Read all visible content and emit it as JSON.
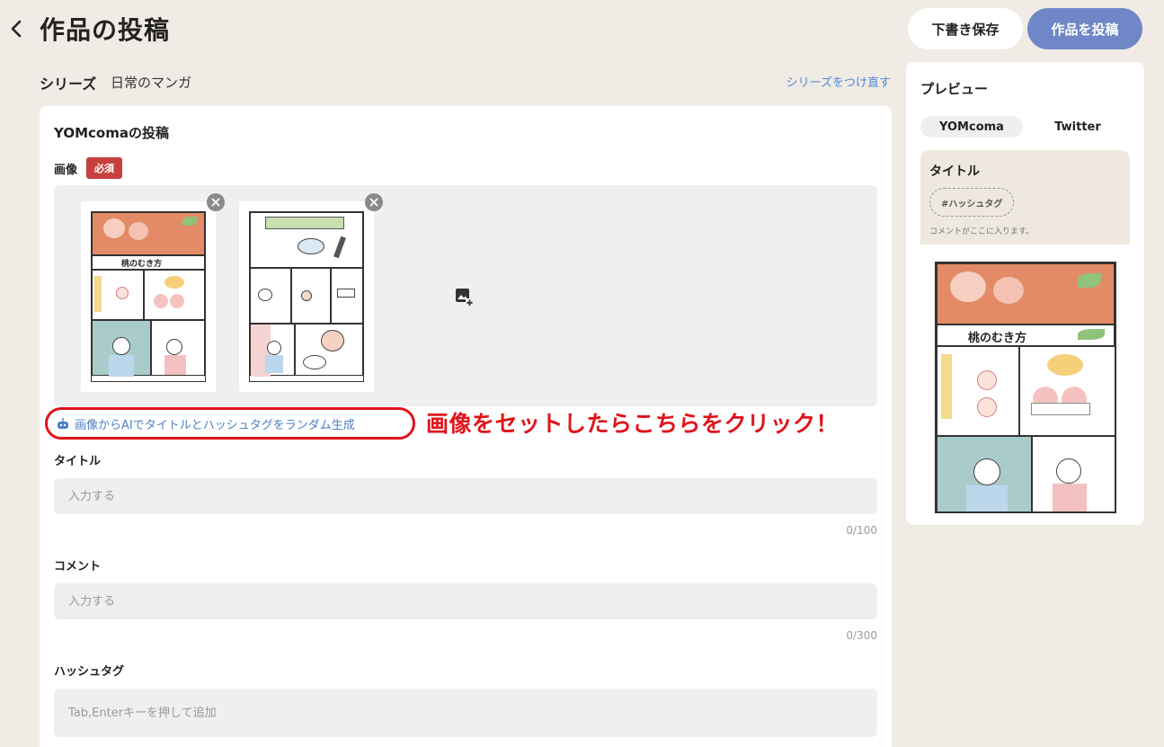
{
  "header": {
    "title": "作品の投稿",
    "draft_label": "下書き保存",
    "post_label": "作品を投稿"
  },
  "series": {
    "label": "シリーズ",
    "value": "日常のマンガ",
    "reset_label": "シリーズをつけ直す"
  },
  "form": {
    "section_title": "YOMcomaの投稿",
    "image_label": "画像",
    "required_label": "必須",
    "ai_generate_label": "画像からAIでタイトルとハッシュタグをランダム生成",
    "annotation": "画像をセットしたらこちらをクリック！",
    "title": {
      "label": "タイトル",
      "placeholder": "入力する",
      "counter": "0/100"
    },
    "comment": {
      "label": "コメント",
      "placeholder": "入力する",
      "counter": "0/300"
    },
    "hashtag": {
      "label": "ハッシュタグ",
      "placeholder": "Tab,Enterキーを押して追加"
    }
  },
  "preview": {
    "title": "プレビュー",
    "tabs": [
      "YOMcoma",
      "Twitter"
    ],
    "active_tab": "YOMcoma",
    "box_title": "タイトル",
    "hashtag_placeholder": "#ハッシュタグ",
    "comment_placeholder": "コメントがここに入ります。",
    "manga_heading": "桃のむき方"
  },
  "thumbnails": {
    "first_heading": "桃のむき方"
  },
  "colors": {
    "background": "#f0ebe4",
    "accent": "#6f87c6",
    "required": "#c8403d",
    "link": "#4d8ad6",
    "annotation": "#e0141b"
  }
}
